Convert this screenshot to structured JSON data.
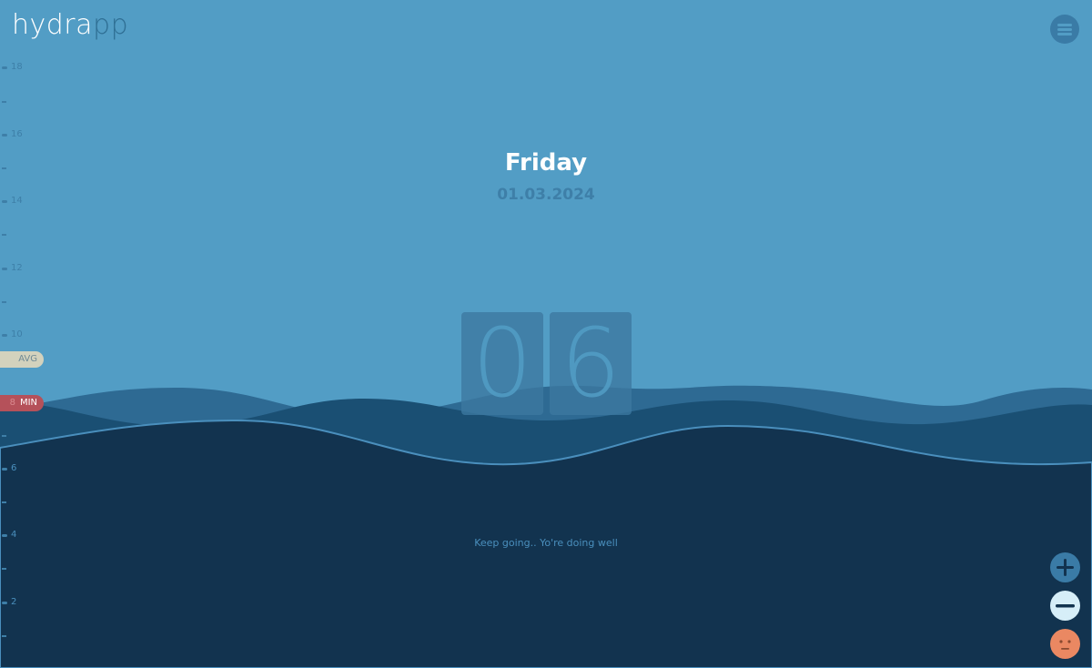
{
  "app": {
    "logo_main": "hydra",
    "logo_accent": "pp"
  },
  "header": {
    "menu_icon": "hamburger-menu-icon"
  },
  "scale": {
    "labels": [
      "18",
      "16",
      "14",
      "12",
      "10",
      "8",
      "6",
      "4",
      "2"
    ],
    "avg_label": "AVG",
    "min_label": "MIN",
    "min_value": "8"
  },
  "day": {
    "name": "Friday",
    "date": "01.03.2024"
  },
  "counter": {
    "digits": [
      "0",
      "6"
    ]
  },
  "message": "Keep going.. Yo're doing well",
  "controls": {
    "add_icon": "plus-icon",
    "remove_icon": "minus-icon",
    "mood_icon": "neutral-face-icon"
  },
  "colors": {
    "sky": "#529dc5",
    "wave_back": "#2e6a93",
    "wave_mid": "#1a4f73",
    "water": "#12334f",
    "avg_marker": "#d3d2bd",
    "min_marker": "#b5515a",
    "mood": "#ea8862"
  }
}
